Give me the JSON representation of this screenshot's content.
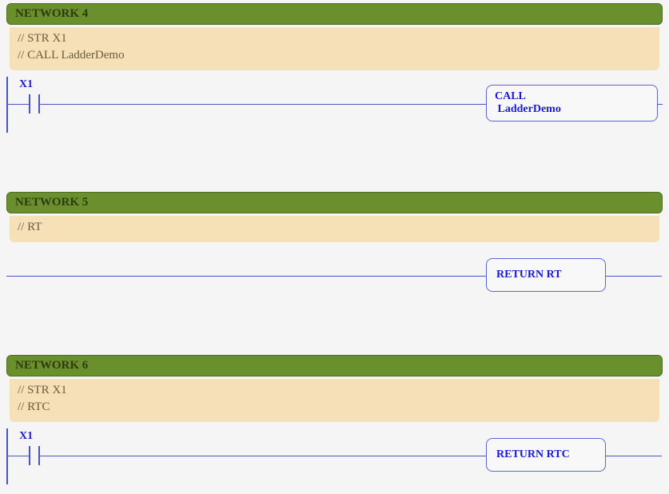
{
  "networks": [
    {
      "title": "NETWORK 4",
      "comments": [
        "// STR X1",
        "// CALL LadderDemo"
      ],
      "contact_label": "X1",
      "box": {
        "line1": "CALL",
        "line2": " LadderDemo"
      }
    },
    {
      "title": "NETWORK 5",
      "comments": [
        "// RT"
      ],
      "contact_label": "",
      "box": {
        "line1": "RETURN RT",
        "line2": ""
      }
    },
    {
      "title": "NETWORK 6",
      "comments": [
        "// STR X1",
        "// RTC"
      ],
      "contact_label": "X1",
      "box": {
        "line1": "RETURN RTC",
        "line2": ""
      }
    }
  ]
}
